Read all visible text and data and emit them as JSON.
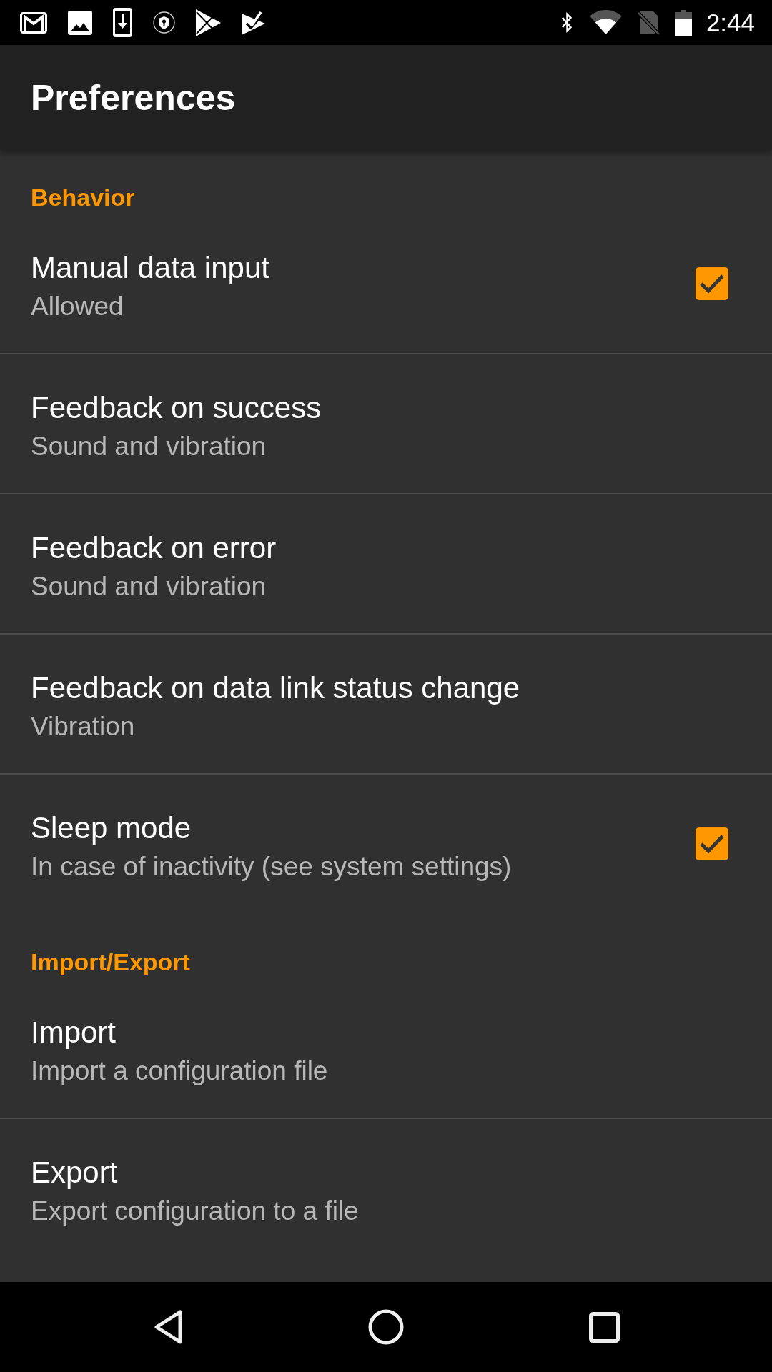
{
  "status_bar": {
    "time": "2:44"
  },
  "app_bar": {
    "title": "Preferences"
  },
  "categories": [
    {
      "title": "Behavior",
      "items": [
        {
          "kind": "checkbox",
          "title": "Manual data input",
          "summary": "Allowed",
          "checked": true
        },
        {
          "kind": "plain",
          "title": "Feedback on success",
          "summary": "Sound and vibration"
        },
        {
          "kind": "plain",
          "title": "Feedback on error",
          "summary": "Sound and vibration"
        },
        {
          "kind": "plain",
          "title": "Feedback on data link status change",
          "summary": "Vibration"
        },
        {
          "kind": "checkbox",
          "title": "Sleep mode",
          "summary": "In case of inactivity (see system settings)",
          "checked": true
        }
      ]
    },
    {
      "title": "Import/Export",
      "items": [
        {
          "kind": "plain",
          "title": "Import",
          "summary": "Import a configuration file"
        },
        {
          "kind": "plain",
          "title": "Export",
          "summary": "Export configuration to a file"
        }
      ]
    }
  ]
}
